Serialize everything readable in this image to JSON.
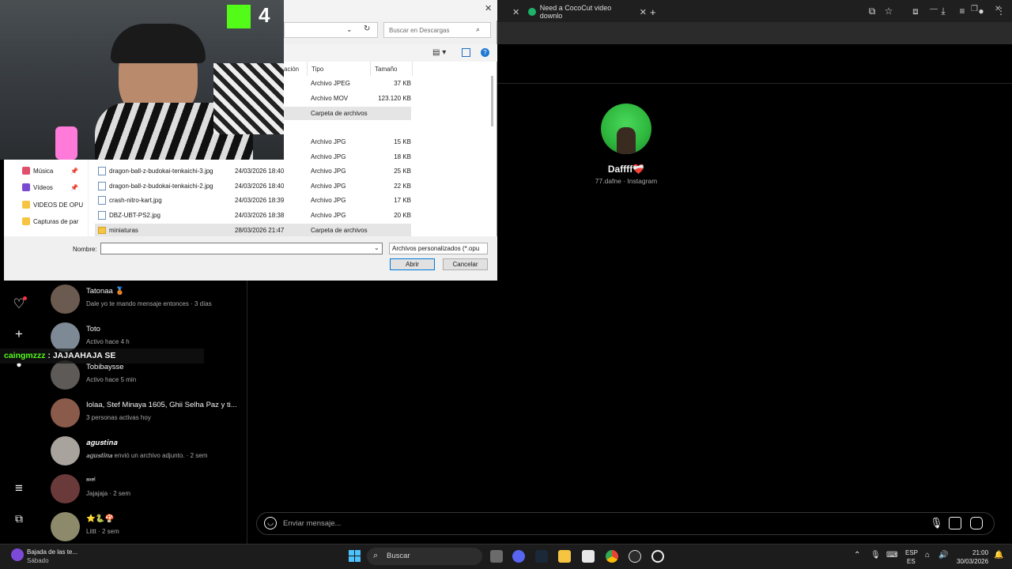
{
  "browser": {
    "tabs": [
      {
        "label": "Need a CocoCut video downlo"
      }
    ],
    "new_tab_label": "+"
  },
  "dialog": {
    "search_placeholder": "Buscar en Descargas",
    "columns": {
      "location_partial": "ación",
      "type": "Tipo",
      "size": "Tamaño"
    },
    "rows": [
      {
        "name": "",
        "date": "",
        "type": "Archivo JPEG",
        "size": "37 KB"
      },
      {
        "name": "",
        "date": "",
        "type": "Archivo MOV",
        "size": "123.120 KB"
      },
      {
        "name": "",
        "date": "",
        "type": "Carpeta de archivos",
        "size": ""
      },
      {
        "name": "",
        "date": "",
        "type": "Archivo JPG",
        "size": "15 KB"
      },
      {
        "name": "",
        "date": "",
        "type": "Archivo JPG",
        "size": "18 KB"
      },
      {
        "name": "dragon-ball-z-budokai-tenkaichi-3.jpg",
        "date": "24/03/2026 18:40",
        "type": "Archivo JPG",
        "size": "25 KB"
      },
      {
        "name": "dragon-ball-z-budokai-tenkaichi-2.jpg",
        "date": "24/03/2026 18:40",
        "type": "Archivo JPG",
        "size": "22 KB"
      },
      {
        "name": "crash-nitro-kart.jpg",
        "date": "24/03/2026 18:39",
        "type": "Archivo JPG",
        "size": "17 KB"
      },
      {
        "name": "DBZ-UBT-PS2.jpg",
        "date": "24/03/2026 18:38",
        "type": "Archivo JPG",
        "size": "20 KB"
      },
      {
        "name": "miniaturas",
        "date": "28/03/2026 21:47",
        "type": "Carpeta de archivos",
        "size": ""
      }
    ],
    "nav": [
      {
        "label": "Música"
      },
      {
        "label": "Vídeos"
      },
      {
        "label": "VIDEOS DE OPU"
      },
      {
        "label": "Capturas de par"
      }
    ],
    "name_label": "Nombre:",
    "name_value": "",
    "filetype": "Archivos personalizados (*.opu",
    "open_label": "Abrir",
    "cancel_label": "Cancelar"
  },
  "stream": {
    "kick_number": "4",
    "chat_user": "caingmzzz",
    "chat_msg": " : JAJAAHAJA SE"
  },
  "instagram": {
    "conversations": [
      {
        "name": "Tatonaa 🥉",
        "sub": "Dale yo te mando mensaje entonces · 3 días",
        "color": "#6b5a4f"
      },
      {
        "name": "Toto",
        "sub": "Activo hace 4 h",
        "color": "#7d8a96"
      },
      {
        "name": "Tobibaysse",
        "sub": "Activo hace 5 min",
        "color": "#5d5a58"
      },
      {
        "name": "Iolaa, Stef Minaya 1605, Ghii Selha Paz y ti...",
        "sub": "3 personas activas hoy",
        "color": "#8a5a4a"
      },
      {
        "name": "𝒂𝒈𝒖𝒔𝒕𝒊𝒏𝒂",
        "sub": "𝒂𝒈𝒖𝒔𝒕𝒊𝒏𝒂 envió un archivo adjunto. · 2 sem",
        "color": "#a8a39c"
      },
      {
        "name": "ᵃˣᵉˡ",
        "sub": "Jajajaja · 2 sem",
        "color": "#6a3a3a"
      },
      {
        "name": "⭐🐍🍄",
        "sub": "Littt · 2 sem",
        "color": "#8c8a6a"
      }
    ],
    "profile": {
      "name": "Daffff❤️‍🩹",
      "sub": "77.dafne · Instagram"
    },
    "message_placeholder": "Enviar mensaje..."
  },
  "taskbar": {
    "notification_title": "Bajada de las te...",
    "notification_sub": "Sábado",
    "search_label": "Buscar",
    "lang1": "ESP",
    "lang2": "ES",
    "time": "21:00",
    "date": "30/03/2026"
  }
}
